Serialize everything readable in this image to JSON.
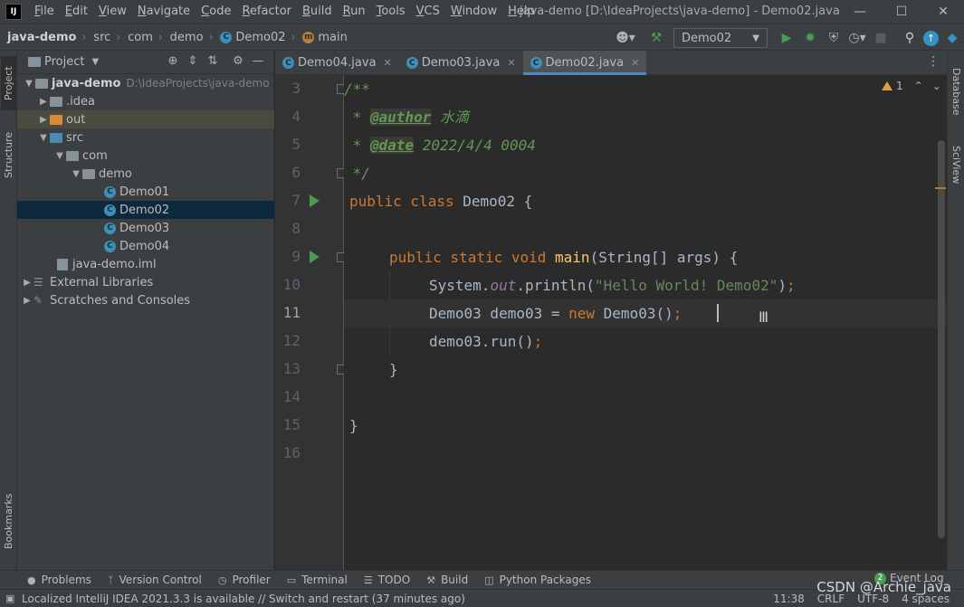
{
  "menu": [
    "File",
    "Edit",
    "View",
    "Navigate",
    "Code",
    "Refactor",
    "Build",
    "Run",
    "Tools",
    "VCS",
    "Window",
    "Help"
  ],
  "window_title": "java-demo [D:\\IdeaProjects\\java-demo] - Demo02.java",
  "logo_text": "IJ",
  "breadcrumb": {
    "project": "java-demo",
    "src": "src",
    "com": "com",
    "demo": "demo",
    "class": "Demo02",
    "method": "main"
  },
  "run_config": "Demo02",
  "left_tabs": {
    "project": "Project",
    "structure": "Structure",
    "bookmarks": "Bookmarks"
  },
  "right_tabs": {
    "database": "Database",
    "sciview": "SciView"
  },
  "project_panel": {
    "title": "Project",
    "root": "java-demo",
    "root_path": "D:\\IdeaProjects\\java-demo",
    "items": [
      {
        "label": "java-demo"
      },
      {
        "label": ".idea"
      },
      {
        "label": "out"
      },
      {
        "label": "src"
      },
      {
        "label": "com"
      },
      {
        "label": "demo"
      },
      {
        "label": "Demo01"
      },
      {
        "label": "Demo02"
      },
      {
        "label": "Demo03"
      },
      {
        "label": "Demo04"
      },
      {
        "label": "java-demo.iml"
      },
      {
        "label": "External Libraries"
      },
      {
        "label": "Scratches and Consoles"
      }
    ]
  },
  "editor_tabs": [
    {
      "label": "Demo04.java"
    },
    {
      "label": "Demo03.java"
    },
    {
      "label": "Demo02.java"
    }
  ],
  "line_numbers": [
    "3",
    "4",
    "5",
    "6",
    "7",
    "8",
    "9",
    "10",
    "11",
    "12",
    "13",
    "14",
    "15",
    "16"
  ],
  "code": {
    "l3": "/**",
    "l4_star": " * ",
    "l4_tag": "@author",
    "l4_val": " 水滴",
    "l5_star": " * ",
    "l5_tag": "@date",
    "l5_val": " 2022/4/4 0004",
    "l6": " */",
    "l7_kw": "public class",
    "l7_name": " Demo02 {",
    "l9_kw": "public static void",
    "l9_fn": "main",
    "l9_rest": "(String[] args) {",
    "l10_a": "System.",
    "l10_field": "out",
    "l10_b": ".println(",
    "l10_str": "\"Hello World! Demo02\"",
    "l10_c": ")",
    "l10_semi": ";",
    "l11_a": "Demo03 demo03 = ",
    "l11_kw": "new",
    "l11_b": " Demo03()",
    "l11_semi": ";",
    "l12_a": "demo03.run()",
    "l12_semi": ";",
    "l13": "}",
    "l15": "}"
  },
  "inspection_count": "1",
  "bottom_tools": [
    "Problems",
    "Version Control",
    "Profiler",
    "Terminal",
    "TODO",
    "Build",
    "Python Packages"
  ],
  "event_log": {
    "count": "2",
    "label": "Event Log"
  },
  "status": {
    "message": "Localized IntelliJ IDEA 2021.3.3 is available // Switch and restart (37 minutes ago)",
    "position": "11:38",
    "line_sep": "CRLF",
    "encoding": "UTF-8",
    "indent": "4 spaces"
  },
  "watermark": "CSDN @Archie_java",
  "colors": {
    "keyword": "#cc7832",
    "comment": "#629755",
    "function": "#ffc66d",
    "string": "#6a8759",
    "field": "#9876aa",
    "run_icon": "#499c54",
    "selection": "#0d293e",
    "accent": "#4a88c7"
  }
}
